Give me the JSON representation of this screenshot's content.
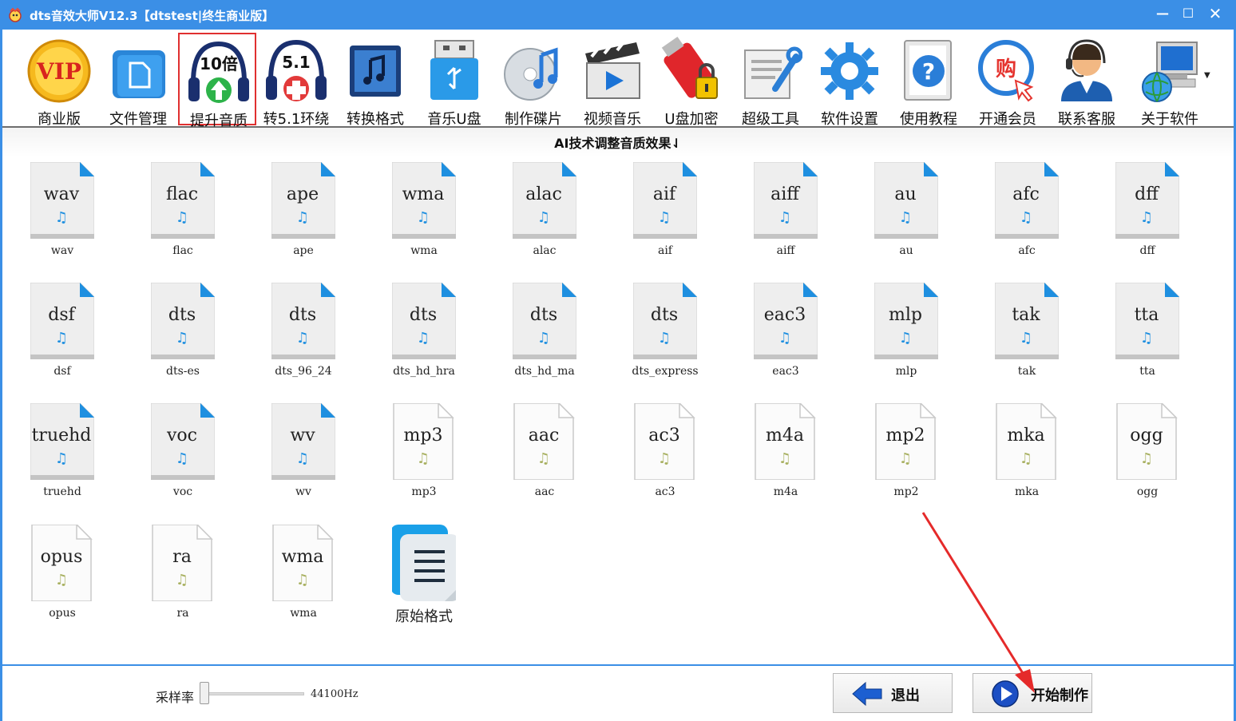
{
  "window": {
    "title": "dts音效大师V12.3【dtstest|终生商业版】",
    "min_glyph": "—",
    "max_glyph": "☐",
    "close_glyph": "✕"
  },
  "toolbar": {
    "items": [
      {
        "label": "商业版",
        "icon": "vip-icon",
        "badge": "VIP"
      },
      {
        "label": "文件管理",
        "icon": "folder-icon"
      },
      {
        "label": "提升音质",
        "icon": "headphones-10x-icon",
        "badge": "10倍"
      },
      {
        "label": "转5.1环绕",
        "icon": "headphones-51-icon",
        "badge": "5.1"
      },
      {
        "label": "转换格式",
        "icon": "music-convert-icon"
      },
      {
        "label": "音乐U盘",
        "icon": "usb-drive-icon"
      },
      {
        "label": "制作碟片",
        "icon": "disc-icon"
      },
      {
        "label": "视频音乐",
        "icon": "clapperboard-icon"
      },
      {
        "label": "U盘加密",
        "icon": "usb-lock-icon"
      },
      {
        "label": "超级工具",
        "icon": "tools-icon"
      },
      {
        "label": "软件设置",
        "icon": "gear-icon"
      },
      {
        "label": "使用教程",
        "icon": "help-icon"
      },
      {
        "label": "开通会员",
        "icon": "shop-icon",
        "badge": "购"
      },
      {
        "label": "联系客服",
        "icon": "support-agent-icon"
      },
      {
        "label": "关于软件",
        "icon": "computer-globe-icon"
      }
    ],
    "selected_index": 2,
    "more_glyph": "▼"
  },
  "section": {
    "heading": "AI技术调整音质效果⇃"
  },
  "formats": [
    {
      "ext": "wav",
      "name": "wav",
      "style": "blue"
    },
    {
      "ext": "flac",
      "name": "flac",
      "style": "blue"
    },
    {
      "ext": "ape",
      "name": "ape",
      "style": "blue"
    },
    {
      "ext": "wma",
      "name": "wma",
      "style": "blue"
    },
    {
      "ext": "alac",
      "name": "alac",
      "style": "blue"
    },
    {
      "ext": "aif",
      "name": "aif",
      "style": "blue"
    },
    {
      "ext": "aiff",
      "name": "aiff",
      "style": "blue"
    },
    {
      "ext": "au",
      "name": "au",
      "style": "blue"
    },
    {
      "ext": "afc",
      "name": "afc",
      "style": "blue"
    },
    {
      "ext": "dff",
      "name": "dff",
      "style": "blue"
    },
    {
      "ext": "dsf",
      "name": "dsf",
      "style": "blue"
    },
    {
      "ext": "dts",
      "name": "dts-es",
      "style": "blue"
    },
    {
      "ext": "dts",
      "name": "dts_96_24",
      "style": "blue"
    },
    {
      "ext": "dts",
      "name": "dts_hd_hra",
      "style": "blue"
    },
    {
      "ext": "dts",
      "name": "dts_hd_ma",
      "style": "blue"
    },
    {
      "ext": "dts",
      "name": "dts_express",
      "style": "blue"
    },
    {
      "ext": "eac3",
      "name": "eac3",
      "style": "blue"
    },
    {
      "ext": "mlp",
      "name": "mlp",
      "style": "blue"
    },
    {
      "ext": "tak",
      "name": "tak",
      "style": "blue"
    },
    {
      "ext": "tta",
      "name": "tta",
      "style": "blue"
    },
    {
      "ext": "truehd",
      "name": "truehd",
      "style": "blue"
    },
    {
      "ext": "voc",
      "name": "voc",
      "style": "blue"
    },
    {
      "ext": "wv",
      "name": "wv",
      "style": "blue"
    },
    {
      "ext": "mp3",
      "name": "mp3",
      "style": "white"
    },
    {
      "ext": "aac",
      "name": "aac",
      "style": "white"
    },
    {
      "ext": "ac3",
      "name": "ac3",
      "style": "white"
    },
    {
      "ext": "m4a",
      "name": "m4a",
      "style": "white"
    },
    {
      "ext": "mp2",
      "name": "mp2",
      "style": "white"
    },
    {
      "ext": "mka",
      "name": "mka",
      "style": "white"
    },
    {
      "ext": "ogg",
      "name": "ogg",
      "style": "white"
    },
    {
      "ext": "opus",
      "name": "opus",
      "style": "white"
    },
    {
      "ext": "ra",
      "name": "ra",
      "style": "white"
    },
    {
      "ext": "wma",
      "name": "wma",
      "style": "white"
    },
    {
      "ext": "",
      "name": "原始格式",
      "style": "original"
    }
  ],
  "note_glyph": "♫",
  "bottom": {
    "sample_rate_label": "采样率",
    "sample_rate_value": "44100Hz",
    "sample_rate_slider_position": 0.0,
    "exit_label": "退出",
    "start_label": "开始制作"
  },
  "colors": {
    "titlebar": "#3b8fe6",
    "selected_border": "#e03030",
    "doc_corner_blue": "#1e8fe0",
    "note_blue": "#1e8fe0",
    "note_green": "#a8b060",
    "annotation_red": "#e52a2a"
  }
}
